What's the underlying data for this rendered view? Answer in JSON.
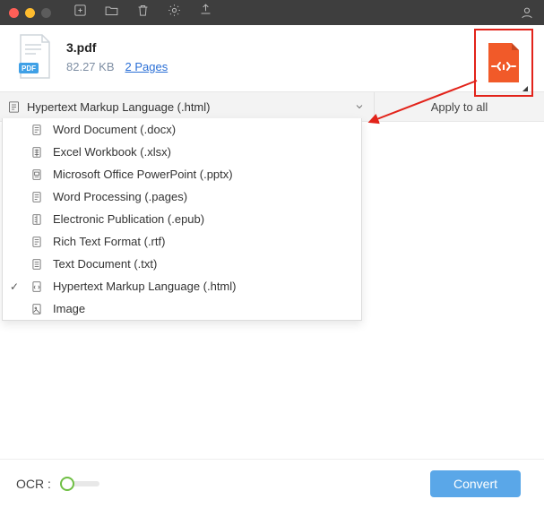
{
  "file": {
    "name": "3.pdf",
    "size": "82.27 KB",
    "pages": "2 Pages"
  },
  "format_bar": {
    "selected": "Hypertext Markup Language (.html)",
    "apply_all": "Apply to all"
  },
  "dropdown": {
    "items": [
      {
        "label": "Word Document (.docx)",
        "checked": false
      },
      {
        "label": "Excel Workbook (.xlsx)",
        "checked": false
      },
      {
        "label": "Microsoft Office PowerPoint (.pptx)",
        "checked": false
      },
      {
        "label": "Word Processing (.pages)",
        "checked": false
      },
      {
        "label": "Electronic Publication (.epub)",
        "checked": false
      },
      {
        "label": "Rich Text Format (.rtf)",
        "checked": false
      },
      {
        "label": "Text Document (.txt)",
        "checked": false
      },
      {
        "label": "Hypertext Markup Language (.html)",
        "checked": true
      },
      {
        "label": "Image",
        "checked": false
      }
    ]
  },
  "footer": {
    "ocr_label": "OCR :",
    "convert_label": "Convert"
  },
  "colors": {
    "highlight_red": "#e2231a",
    "convert_blue": "#5aa7e8",
    "link_blue": "#2a6fd6",
    "target_orange": "#f15a29"
  }
}
